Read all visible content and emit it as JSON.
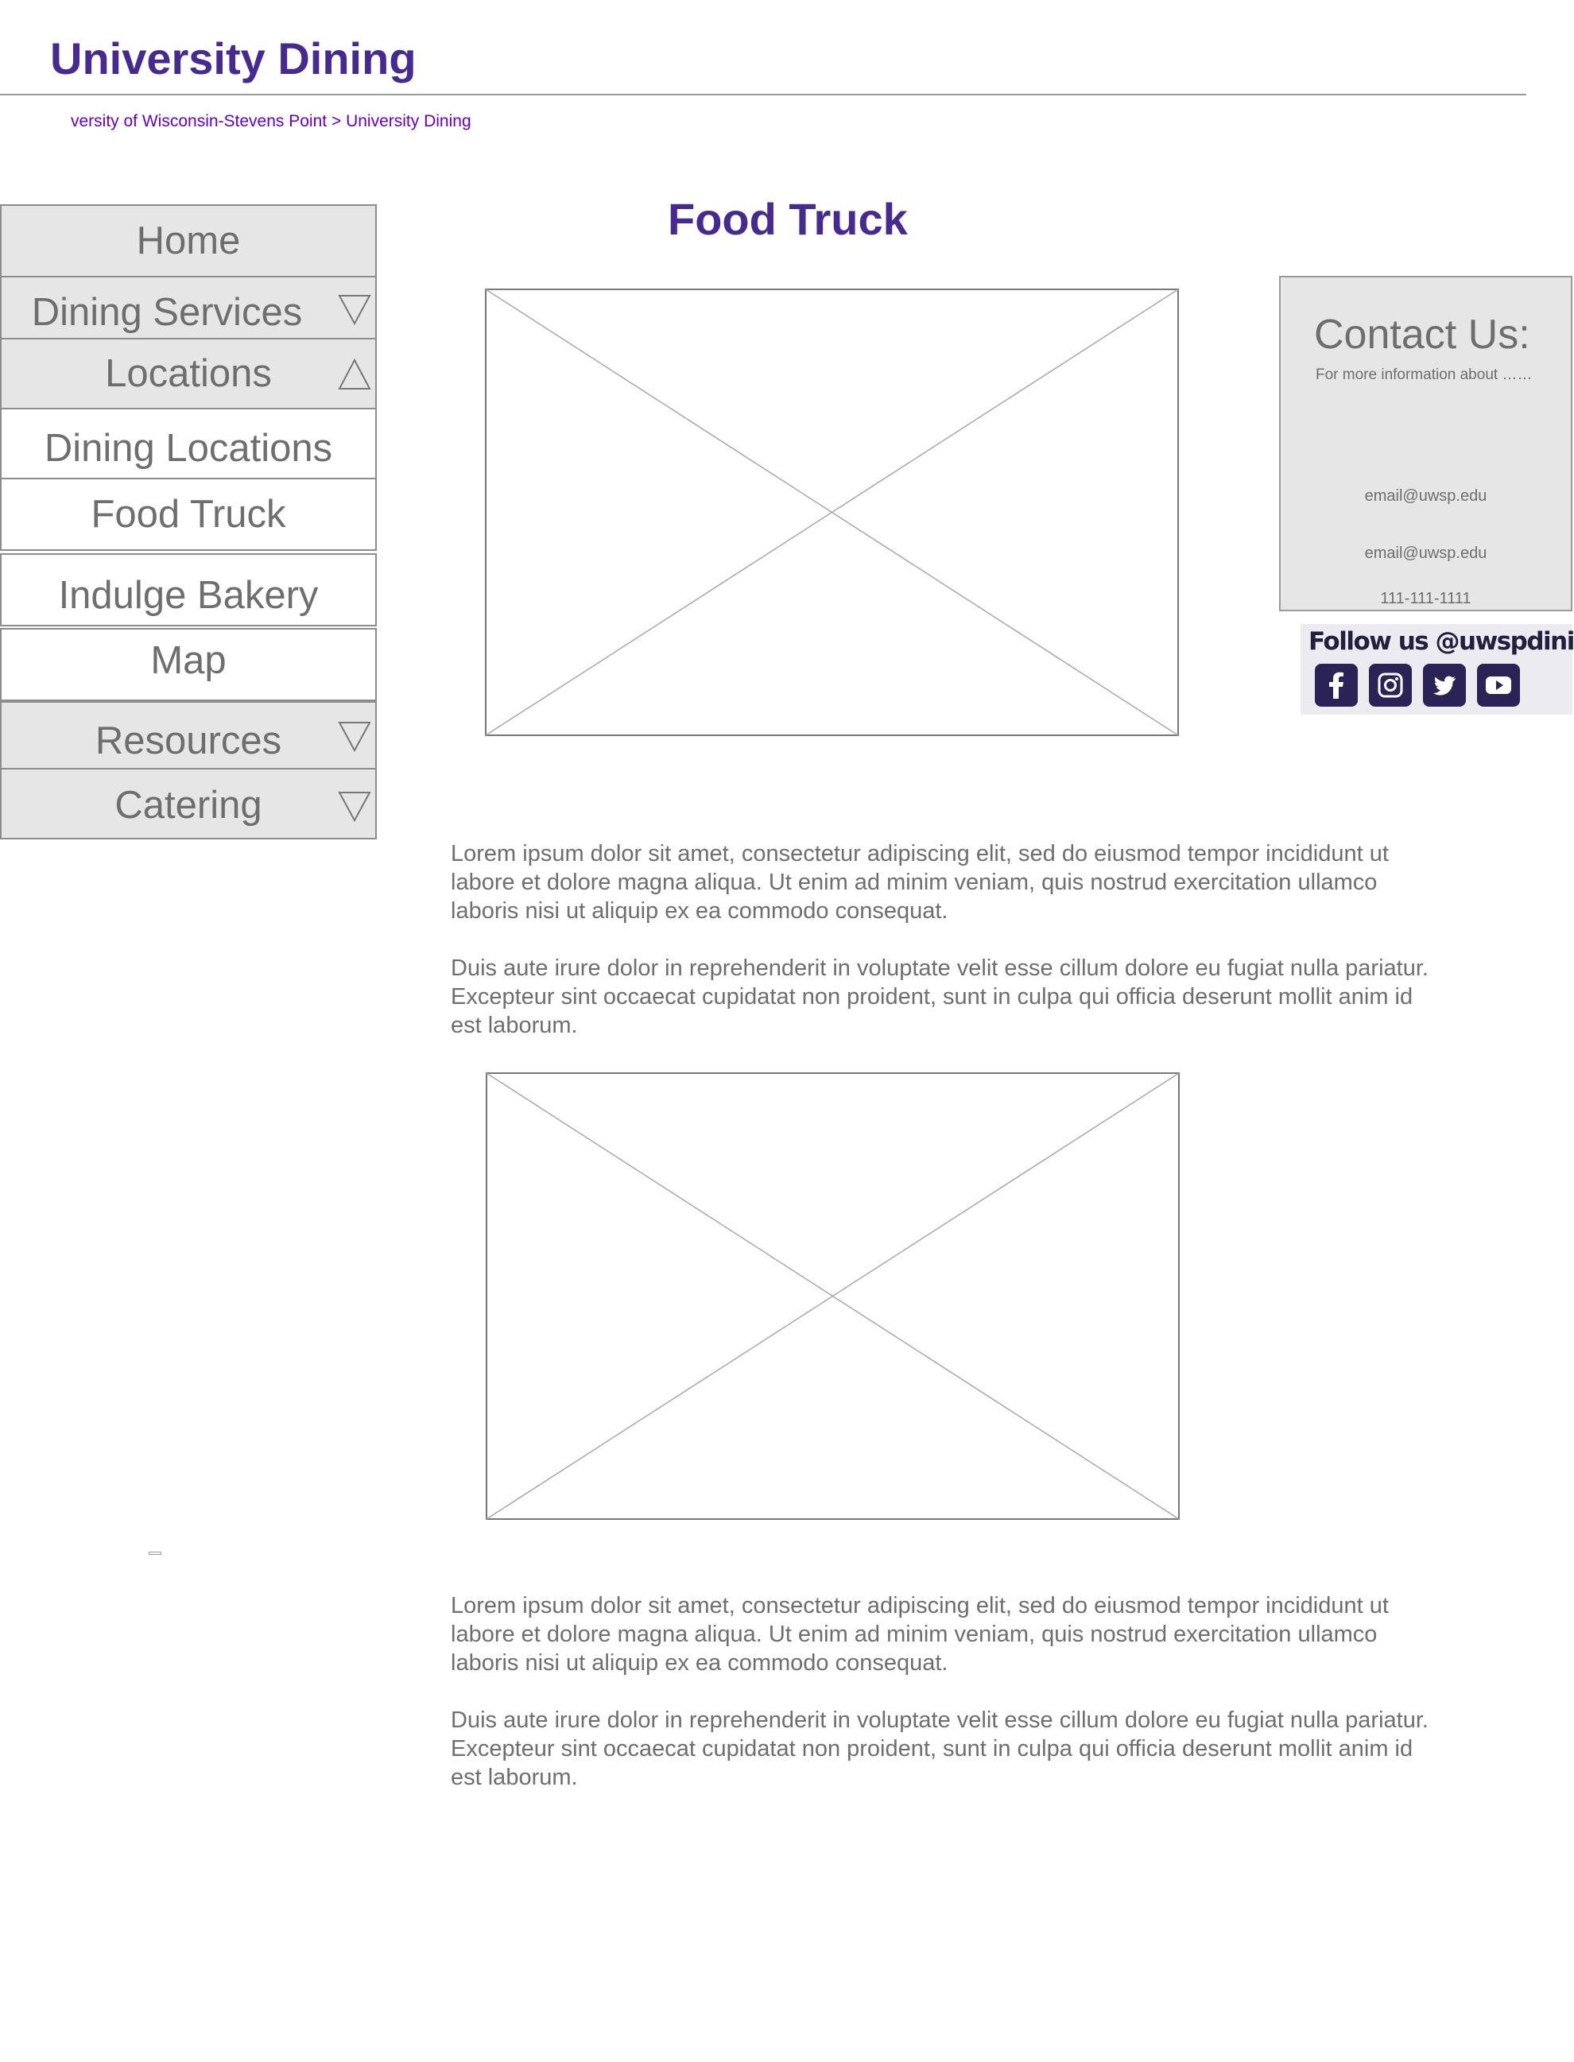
{
  "header": {
    "title": "University Dining",
    "breadcrumb": {
      "parent": "versity of Wisconsin-Stevens Point",
      "separator": ">",
      "current": "University Dining"
    }
  },
  "sidebar": {
    "items": [
      {
        "label": "Home"
      },
      {
        "label": "Dining Services",
        "arrow": "down-triangle-icon"
      },
      {
        "label": "Locations",
        "arrow": "up-triangle-icon"
      },
      {
        "label": "Dining Locations"
      },
      {
        "label": "Food Truck"
      },
      {
        "label": "Indulge Bakery"
      },
      {
        "label": "Map"
      },
      {
        "label": "Resources",
        "arrow": "down-triangle-icon"
      },
      {
        "label": "Catering",
        "arrow": "down-triangle-icon"
      }
    ]
  },
  "main": {
    "title": "Food Truck",
    "sections": [
      {
        "paragraphs": [
          "Lorem ipsum dolor sit amet, consectetur adipiscing elit, sed do eiusmod tempor incididunt ut labore et dolore magna aliqua. Ut enim ad minim veniam, quis nostrud exercitation ullamco laboris nisi ut aliquip ex ea commodo consequat.",
          "Duis aute irure dolor in reprehenderit in voluptate velit esse cillum dolore eu fugiat nulla pariatur. Excepteur sint occaecat cupidatat non proident, sunt in culpa qui officia deserunt mollit anim id est laborum."
        ]
      },
      {
        "paragraphs": [
          "Lorem ipsum dolor sit amet, consectetur adipiscing elit, sed do eiusmod tempor incididunt ut labore et dolore magna aliqua. Ut enim ad minim veniam, quis nostrud exercitation ullamco laboris nisi ut aliquip ex ea commodo consequat.",
          "Duis aute irure dolor in reprehenderit in voluptate velit esse cillum dolore eu fugiat nulla pariatur. Excepteur sint occaecat cupidatat non proident, sunt in culpa qui officia deserunt mollit anim id est laborum."
        ]
      }
    ]
  },
  "contact": {
    "heading": "Contact Us:",
    "info": "For more information about ……",
    "email_1": "email@uwsp.edu",
    "email_2": "email@uwsp.edu",
    "phone": "111-111-1111"
  },
  "social": {
    "heading": "Follow us @uwspdining",
    "icons": [
      "facebook-icon",
      "instagram-icon",
      "twitter-icon",
      "youtube-icon"
    ]
  },
  "colors": {
    "brand_purple": "#472A91",
    "breadcrumb_link": "#6600CC",
    "nav_grey": "#e6e6e6",
    "text_grey": "#6e6e6e",
    "social_button": "#2a2355"
  }
}
